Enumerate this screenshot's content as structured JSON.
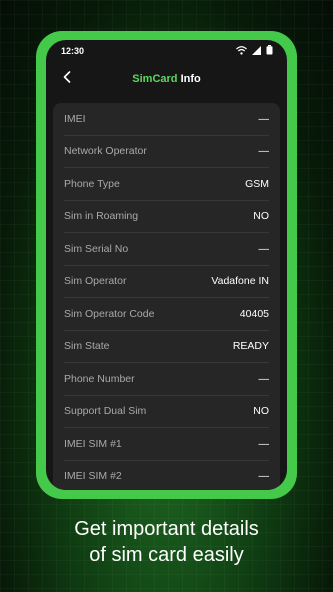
{
  "status_bar": {
    "time": "12:30"
  },
  "header": {
    "title_accent": "SimCard",
    "title_rest": " Info"
  },
  "rows": [
    {
      "label": "IMEI",
      "value": "—"
    },
    {
      "label": "Network Operator",
      "value": "—"
    },
    {
      "label": "Phone Type",
      "value": "GSM"
    },
    {
      "label": "Sim in Roaming",
      "value": "NO"
    },
    {
      "label": "Sim Serial No",
      "value": "—"
    },
    {
      "label": "Sim Operator",
      "value": "Vadafone IN"
    },
    {
      "label": "Sim Operator Code",
      "value": "40405"
    },
    {
      "label": "Sim State",
      "value": "READY"
    },
    {
      "label": "Phone Number",
      "value": "—"
    },
    {
      "label": "Support Dual Sim",
      "value": "NO"
    },
    {
      "label": "IMEI SIM #1",
      "value": "—"
    },
    {
      "label": "IMEI SIM #2",
      "value": "—"
    }
  ],
  "caption": {
    "line1": "Get important details",
    "line2": "of sim card easily"
  },
  "colors": {
    "accent": "#5ed65e",
    "frame": "#45c94a",
    "screen": "#161616",
    "card": "#262626"
  },
  "icons": [
    "wifi-icon",
    "signal-icon",
    "battery-icon",
    "back-arrow-icon"
  ]
}
